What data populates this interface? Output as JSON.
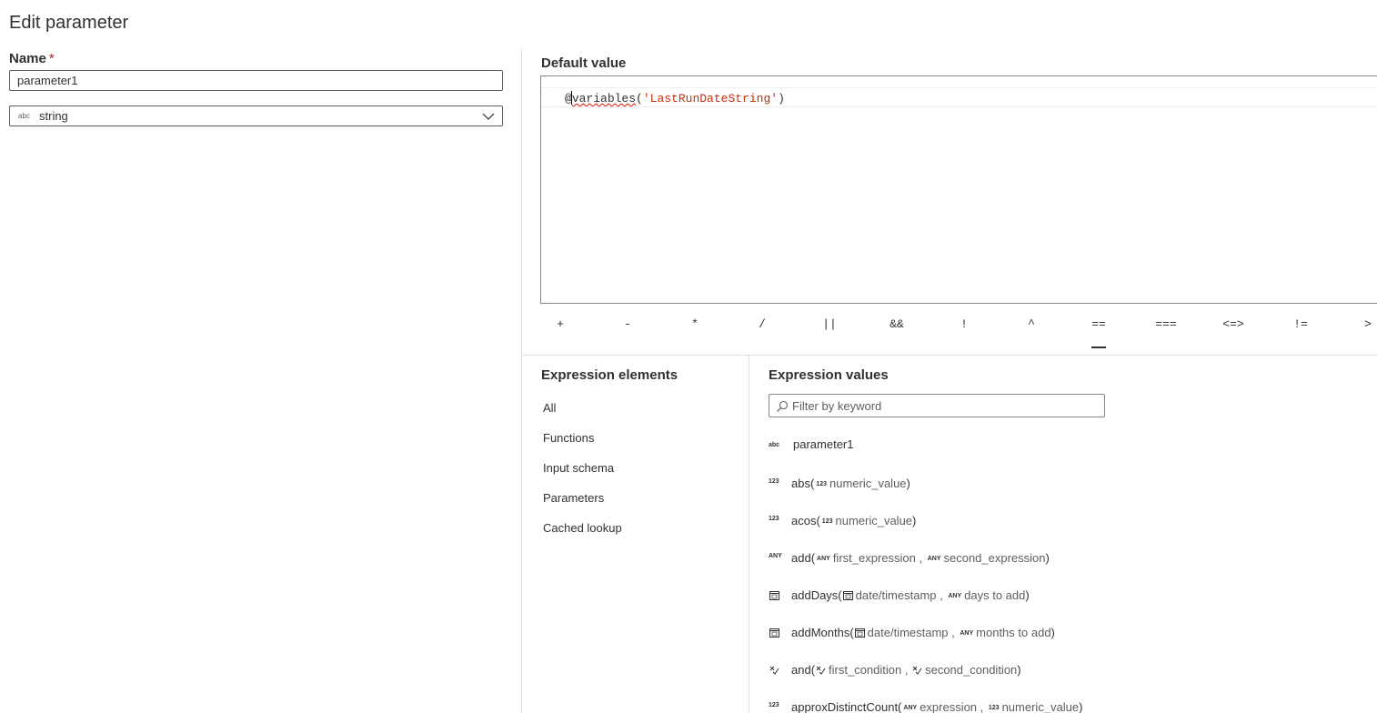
{
  "page": {
    "title": "Edit parameter"
  },
  "name_field": {
    "label": "Name",
    "required_mark": "*",
    "value": "parameter1"
  },
  "type_select": {
    "tag": "abc",
    "value": "string"
  },
  "default_value": {
    "label": "Default value",
    "code_prefix": "@",
    "code_fn": "variables",
    "code_open": "(",
    "code_str": "'LastRunDateString'",
    "code_close": ")"
  },
  "operators": [
    "+",
    "-",
    "*",
    "/",
    "||",
    "&&",
    "!",
    "^",
    "==",
    "===",
    "<=>",
    "!=",
    ">"
  ],
  "active_operator": "==",
  "expression_elements": {
    "title": "Expression elements",
    "items": [
      "All",
      "Functions",
      "Input schema",
      "Parameters",
      "Cached lookup"
    ]
  },
  "expression_values": {
    "title": "Expression values",
    "filter_placeholder": "Filter by keyword",
    "items": [
      {
        "icon": "abc",
        "name": "parameter1"
      },
      {
        "icon": "123",
        "name": "abs(",
        "args": [
          {
            "type": "123",
            "label": "numeric_value"
          }
        ],
        "close": ")"
      },
      {
        "icon": "123",
        "name": "acos(",
        "args": [
          {
            "type": "123",
            "label": "numeric_value"
          }
        ],
        "close": ")"
      },
      {
        "icon": "ANY",
        "name": "add(",
        "args": [
          {
            "type": "ANY",
            "label": "first_expression"
          },
          {
            "type": "ANY",
            "label": "second_expression"
          }
        ],
        "close": ")"
      },
      {
        "icon": "date",
        "name": "addDays(",
        "args": [
          {
            "type": "date",
            "label": "date/timestamp"
          },
          {
            "type": "ANY",
            "label": "days to add"
          }
        ],
        "close": ")"
      },
      {
        "icon": "date",
        "name": "addMonths(",
        "args": [
          {
            "type": "date",
            "label": "date/timestamp"
          },
          {
            "type": "ANY",
            "label": "months to add"
          }
        ],
        "close": ")"
      },
      {
        "icon": "bool",
        "name": "and(",
        "args": [
          {
            "type": "bool",
            "label": "first_condition"
          },
          {
            "type": "bool",
            "label": "second_condition"
          }
        ],
        "close": ")"
      },
      {
        "icon": "123",
        "name": "approxDistinctCount(",
        "args": [
          {
            "type": "ANY",
            "label": "expression"
          },
          {
            "type": "123",
            "label": "numeric_value"
          }
        ],
        "close": ")"
      }
    ]
  }
}
